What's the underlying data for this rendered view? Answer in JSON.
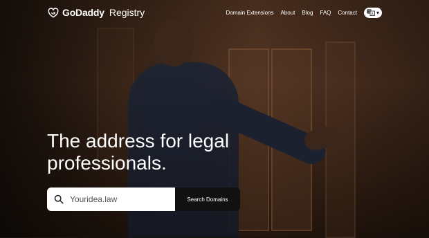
{
  "header": {
    "brand": "GoDaddy",
    "brand_sub": "Registry",
    "nav": [
      {
        "label": "Domain Extensions"
      },
      {
        "label": "About"
      },
      {
        "label": "Blog"
      },
      {
        "label": "FAQ"
      },
      {
        "label": "Contact"
      }
    ],
    "language_icon": "translate-icon",
    "language_caret": "▾"
  },
  "hero": {
    "headline_line1": "The address for legal",
    "headline_line2": "professionals."
  },
  "search": {
    "placeholder": "Youridea.law",
    "value": "",
    "button_label": "Search Domains",
    "icon": "search-icon"
  },
  "colors": {
    "text": "#ffffff",
    "search_bg": "#ffffff",
    "button_bg": "#111111"
  }
}
